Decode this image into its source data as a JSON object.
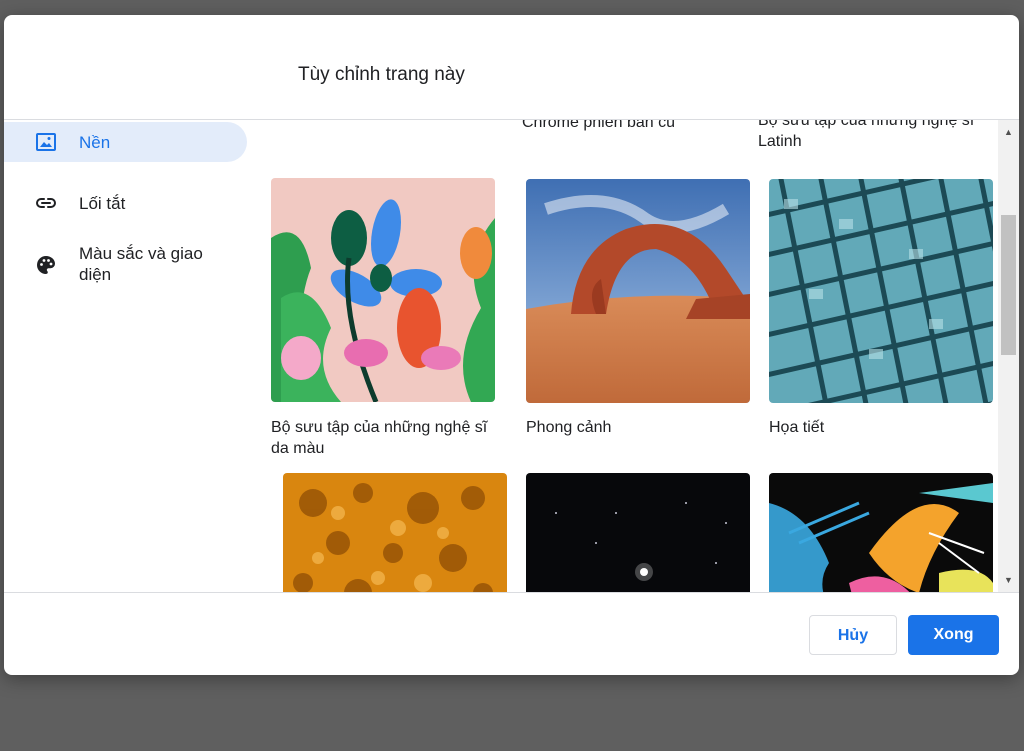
{
  "dialog": {
    "title": "Tùy chỉnh trang này"
  },
  "sidebar": {
    "items": [
      {
        "label": "Nền",
        "icon": "image-icon",
        "active": true
      },
      {
        "label": "Lối tắt",
        "icon": "link-icon",
        "active": false
      },
      {
        "label": "Màu sắc và giao\ndiện",
        "icon": "palette-icon",
        "active": false
      }
    ]
  },
  "collections": {
    "cut_off_labels": [
      "Chrome phiên bản cũ",
      "Bộ sưu tập của những nghệ sĩ\nLatinh"
    ],
    "tiles": [
      {
        "label": "Bộ sưu tập của những nghệ sĩ\nda màu"
      },
      {
        "label": "Phong cảnh"
      },
      {
        "label": "Họa tiết"
      },
      {
        "label": ""
      },
      {
        "label": ""
      },
      {
        "label": ""
      }
    ]
  },
  "footer": {
    "cancel_label": "Hủy",
    "done_label": "Xong"
  },
  "colors": {
    "accent": "#1a73e8",
    "active_nav_bg": "#e3ecfa",
    "backdrop": "#5f5f5f"
  }
}
